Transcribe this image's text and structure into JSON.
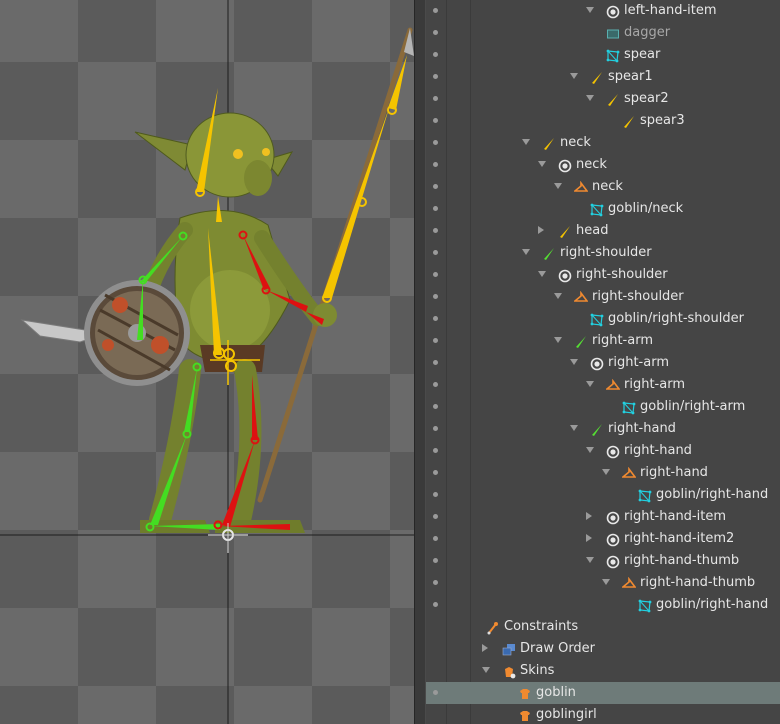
{
  "viewport": {
    "canvas_bg": "#6a6a6a",
    "bone_colors": {
      "yellow": "#f5c400",
      "green": "#44dd22",
      "red": "#dd1111"
    }
  },
  "tree": {
    "rows": [
      {
        "label": "left-hand-item",
        "icon": "slot-icon",
        "arrow": "down"
      },
      {
        "label": "dagger",
        "icon": "region-icon",
        "dim": true
      },
      {
        "label": "spear",
        "icon": "mesh-icon"
      },
      {
        "label": "spear1",
        "icon": "bone-icon",
        "arrow": "down"
      },
      {
        "label": "spear2",
        "icon": "bone-icon",
        "arrow": "down"
      },
      {
        "label": "spear3",
        "icon": "bone-icon"
      },
      {
        "label": "neck",
        "icon": "bone-icon",
        "arrow": "down"
      },
      {
        "label": "neck",
        "icon": "slot-icon",
        "arrow": "down"
      },
      {
        "label": "neck",
        "icon": "hanger-icon",
        "arrow": "down"
      },
      {
        "label": "goblin/neck",
        "icon": "mesh-icon"
      },
      {
        "label": "head",
        "icon": "bone-icon",
        "arrow": "right"
      },
      {
        "label": "right-shoulder",
        "icon": "bone-icon-green",
        "arrow": "down"
      },
      {
        "label": "right-shoulder",
        "icon": "slot-icon",
        "arrow": "down"
      },
      {
        "label": "right-shoulder",
        "icon": "hanger-icon",
        "arrow": "down"
      },
      {
        "label": "goblin/right-shoulder",
        "icon": "mesh-icon"
      },
      {
        "label": "right-arm",
        "icon": "bone-icon-green",
        "arrow": "down"
      },
      {
        "label": "right-arm",
        "icon": "slot-icon",
        "arrow": "down"
      },
      {
        "label": "right-arm",
        "icon": "hanger-icon",
        "arrow": "down"
      },
      {
        "label": "goblin/right-arm",
        "icon": "mesh-icon"
      },
      {
        "label": "right-hand",
        "icon": "bone-icon-green",
        "arrow": "down"
      },
      {
        "label": "right-hand",
        "icon": "slot-icon",
        "arrow": "down"
      },
      {
        "label": "right-hand",
        "icon": "hanger-icon",
        "arrow": "down"
      },
      {
        "label": "goblin/right-hand",
        "icon": "mesh-icon"
      },
      {
        "label": "right-hand-item",
        "icon": "slot-icon",
        "arrow": "right"
      },
      {
        "label": "right-hand-item2",
        "icon": "slot-icon",
        "arrow": "right"
      },
      {
        "label": "right-hand-thumb",
        "icon": "slot-icon",
        "arrow": "down"
      },
      {
        "label": "right-hand-thumb",
        "icon": "hanger-icon",
        "arrow": "down"
      },
      {
        "label": "goblin/right-hand",
        "icon": "mesh-icon"
      },
      {
        "label": "Constraints",
        "icon": "constraints-icon"
      },
      {
        "label": "Draw Order",
        "icon": "draw-order-icon",
        "arrow": "right"
      },
      {
        "label": "Skins",
        "icon": "skins-icon",
        "arrow": "down"
      },
      {
        "label": "goblin",
        "icon": "skin-icon",
        "selected": true
      },
      {
        "label": "goblingirl",
        "icon": "skin-icon"
      }
    ]
  }
}
